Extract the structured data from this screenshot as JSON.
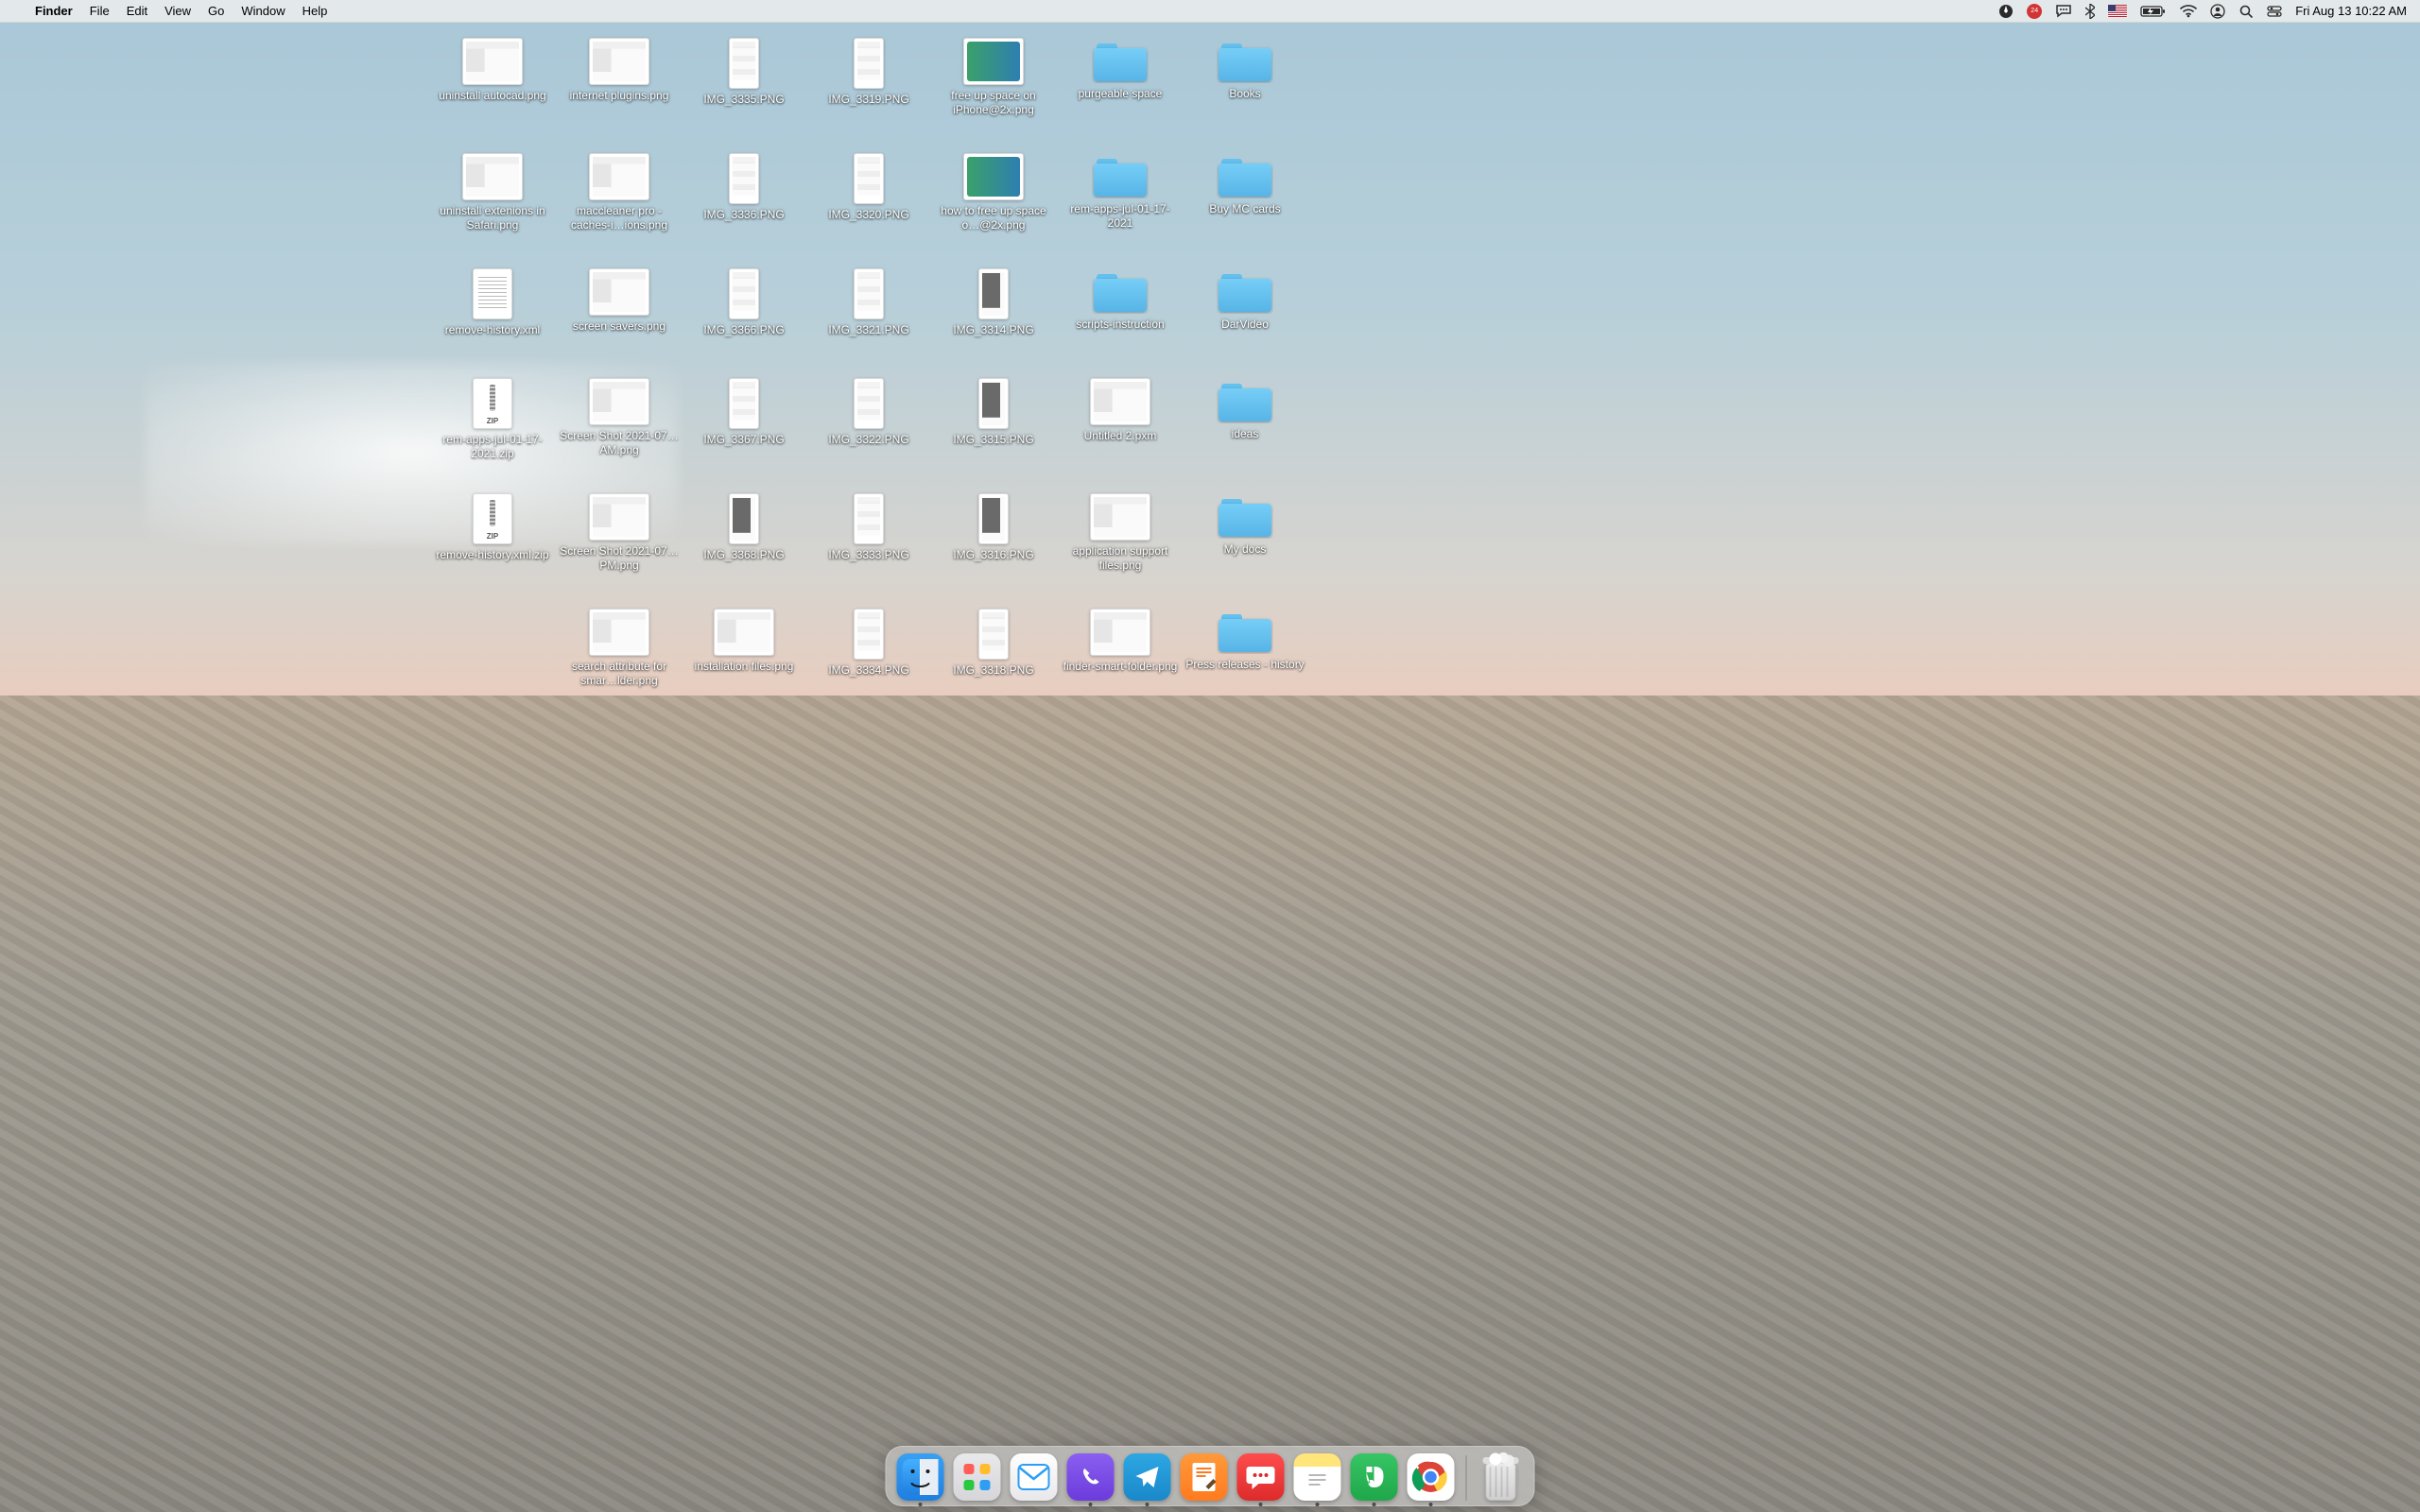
{
  "menubar": {
    "app": "Finder",
    "items": [
      "File",
      "Edit",
      "View",
      "Go",
      "Window",
      "Help"
    ],
    "notification_count": "24",
    "clock": "Fri Aug 13  10:22 AM"
  },
  "desktop": {
    "col_x": [
      521,
      655,
      787,
      919,
      1051,
      1185,
      1317
    ],
    "row_y": [
      40,
      162,
      284,
      400,
      522,
      644
    ],
    "items": [
      {
        "col": 0,
        "row": 0,
        "type": "wide",
        "label": "uninstall autocad.png"
      },
      {
        "col": 1,
        "row": 0,
        "type": "wide",
        "label": "internet plugins.png"
      },
      {
        "col": 2,
        "row": 0,
        "type": "tall",
        "label": "IMG_3335.PNG"
      },
      {
        "col": 3,
        "row": 0,
        "type": "tall",
        "label": "IMG_3319.PNG"
      },
      {
        "col": 4,
        "row": 0,
        "type": "photob",
        "label": "free up space on iPhone@2x.png"
      },
      {
        "col": 5,
        "row": 0,
        "type": "folder",
        "label": "purgeable space"
      },
      {
        "col": 6,
        "row": 0,
        "type": "folder",
        "label": "Books"
      },
      {
        "col": 0,
        "row": 1,
        "type": "wide",
        "label": "uninstall extenions in Safari.png"
      },
      {
        "col": 1,
        "row": 1,
        "type": "wide",
        "label": "maccleaner pro - caches-i…ions.png"
      },
      {
        "col": 2,
        "row": 1,
        "type": "tall",
        "label": "IMG_3336.PNG"
      },
      {
        "col": 3,
        "row": 1,
        "type": "tall",
        "label": "IMG_3320.PNG"
      },
      {
        "col": 4,
        "row": 1,
        "type": "photob",
        "label": "how to free up space o…@2x.png"
      },
      {
        "col": 5,
        "row": 1,
        "type": "folder",
        "label": "rem-apps-jul-01-17-2021"
      },
      {
        "col": 6,
        "row": 1,
        "type": "folder",
        "label": "Buy MC cards"
      },
      {
        "col": 0,
        "row": 2,
        "type": "doc",
        "label": "remove-history.xml"
      },
      {
        "col": 1,
        "row": 2,
        "type": "wide",
        "label": "screen savers.png"
      },
      {
        "col": 2,
        "row": 2,
        "type": "tall",
        "label": "IMG_3366.PNG"
      },
      {
        "col": 3,
        "row": 2,
        "type": "tall",
        "label": "IMG_3321.PNG"
      },
      {
        "col": 4,
        "row": 2,
        "type": "tall photo",
        "label": "IMG_3314.PNG"
      },
      {
        "col": 5,
        "row": 2,
        "type": "folder",
        "label": "scripts-instruction"
      },
      {
        "col": 6,
        "row": 2,
        "type": "folder",
        "label": "DarVideo"
      },
      {
        "col": 0,
        "row": 3,
        "type": "zip",
        "label": "rem-apps-jul-01-17-2021.zip",
        "zip": "ZIP"
      },
      {
        "col": 1,
        "row": 3,
        "type": "wide",
        "label": "Screen Shot 2021-07…AM.png"
      },
      {
        "col": 2,
        "row": 3,
        "type": "tall",
        "label": "IMG_3367.PNG"
      },
      {
        "col": 3,
        "row": 3,
        "type": "tall",
        "label": "IMG_3322.PNG"
      },
      {
        "col": 4,
        "row": 3,
        "type": "tall photo",
        "label": "IMG_3315.PNG"
      },
      {
        "col": 5,
        "row": 3,
        "type": "wide",
        "label": "Untitled 2.pxm"
      },
      {
        "col": 6,
        "row": 3,
        "type": "folder",
        "label": "ideas"
      },
      {
        "col": 0,
        "row": 4,
        "type": "zip",
        "label": "remove-history.xml.zip",
        "zip": "ZIP"
      },
      {
        "col": 1,
        "row": 4,
        "type": "wide",
        "label": "Screen Shot 2021-07…PM.png"
      },
      {
        "col": 2,
        "row": 4,
        "type": "tall photo",
        "label": "IMG_3368.PNG"
      },
      {
        "col": 3,
        "row": 4,
        "type": "tall",
        "label": "IMG_3333.PNG"
      },
      {
        "col": 4,
        "row": 4,
        "type": "tall photo",
        "label": "IMG_3316.PNG"
      },
      {
        "col": 5,
        "row": 4,
        "type": "wide",
        "label": "application support files.png"
      },
      {
        "col": 6,
        "row": 4,
        "type": "folder",
        "label": "My docs"
      },
      {
        "col": 1,
        "row": 5,
        "type": "wide",
        "label": "search attribute for smar…lder.png"
      },
      {
        "col": 2,
        "row": 5,
        "type": "wide",
        "label": "installation files.png"
      },
      {
        "col": 3,
        "row": 5,
        "type": "tall",
        "label": "IMG_3334.PNG"
      },
      {
        "col": 4,
        "row": 5,
        "type": "tall",
        "label": "IMG_3318.PNG"
      },
      {
        "col": 5,
        "row": 5,
        "type": "wide",
        "label": "finder-smart-folder.png"
      },
      {
        "col": 6,
        "row": 5,
        "type": "folder",
        "label": "Press releases - history"
      }
    ]
  },
  "dock": {
    "apps": [
      {
        "name": "finder",
        "bg": "linear-gradient(#3aa0f3,#1f7fe0)",
        "running": true
      },
      {
        "name": "launchpad",
        "bg": "linear-gradient(#e9e9ec,#d6d6da)",
        "running": false
      },
      {
        "name": "mail",
        "bg": "linear-gradient(#ffffff,#e8e8ea)",
        "running": false
      },
      {
        "name": "viber",
        "bg": "linear-gradient(#8b5ff0,#6b3bdc)",
        "running": true
      },
      {
        "name": "telegram",
        "bg": "linear-gradient(#2da7e3,#1a88c9)",
        "running": true
      },
      {
        "name": "pages",
        "bg": "linear-gradient(#ff9a3a,#ff7a1f)",
        "running": false
      },
      {
        "name": "imessage-red",
        "bg": "linear-gradient(#ff4c4c,#dd2a2a)",
        "running": true
      },
      {
        "name": "notes",
        "bg": "linear-gradient(#ffe57a 0 28%, #fff 28%)",
        "running": true
      },
      {
        "name": "evernote",
        "bg": "linear-gradient(#37c565,#1fa74a)",
        "running": true
      },
      {
        "name": "chrome",
        "bg": "#ffffff",
        "running": true
      }
    ]
  }
}
